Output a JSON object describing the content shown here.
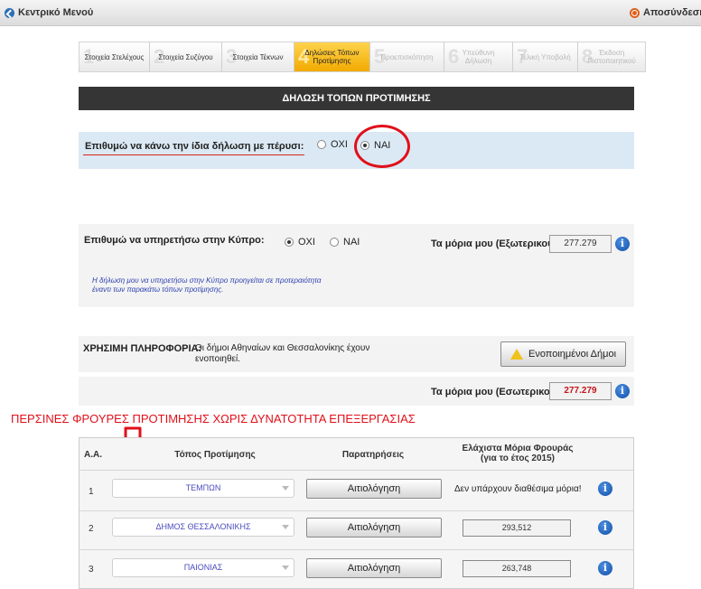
{
  "topbar": {
    "menu_label": "Κεντρικό Μενού",
    "logout_label": "Αποσύνδεση"
  },
  "steps": [
    {
      "num": "1",
      "label": "Στοιχεία Στελέχους",
      "state": "done"
    },
    {
      "num": "2",
      "label": "Στοιχεία Συζύγου",
      "state": "done"
    },
    {
      "num": "3",
      "label": "Στοιχεία Τέκνων",
      "state": "done"
    },
    {
      "num": "4",
      "label": "Δηλώσεις Τόπων Προτίμησης",
      "state": "active"
    },
    {
      "num": "5",
      "label": "Προεπισκόπηση",
      "state": "future"
    },
    {
      "num": "6",
      "label": "Υπεύθυνη Δήλωση",
      "state": "future"
    },
    {
      "num": "7",
      "label": "Τελική Υποβολή",
      "state": "future"
    },
    {
      "num": "8",
      "label": "Έκδοση Πιστοποιητικού",
      "state": "future"
    }
  ],
  "section_title": "ΔΗΛΩΣΗ ΤΟΠΩΝ ΠΡΟΤΙΜΗΣΗΣ",
  "same_as_last_year": {
    "question": "Επιθυμώ να κάνω την ίδια δήλωση με πέρυσι:",
    "option_no": "ΟΧΙ",
    "option_yes": "ΝΑΙ",
    "selected": "yes"
  },
  "cyprus": {
    "question": "Επιθυμώ να υπηρετήσω στην Κύπρο:",
    "option_no": "ΟΧΙ",
    "option_yes": "ΝΑΙ",
    "selected": "no",
    "points_label": "Τα μόρια μου (Εξωτερικού):",
    "points_value": "277.279",
    "note_line1": "Η δήλωση μου να υπηρετήσω στην Κύπρο προηγείται σε προτεραιότητα",
    "note_line2": "έναντι των παρακάτω τόπων προτίμησης."
  },
  "useful_info": {
    "title": "ΧΡΗΣΙΜΗ ΠΛΗΡΟΦΟΡΙΑ:",
    "text_line1": "Οι δήμοι Αθηναίων και Θεσσαλονίκης έχουν",
    "text_line2": "ενοποιηθεί.",
    "button_label": "Ενοποιημένοι Δήμοι"
  },
  "domestic_points": {
    "label": "Τα μόρια μου (Εσωτερικού):",
    "value": "277.279"
  },
  "annotation": "ΠΕΡΣΙΝΕΣ ΦΡΟΥΡΕΣ ΠΡΟΤΙΜΗΣΗΣ ΧΩΡΙΣ ΔΥΝΑΤΟΤΗΤΑ ΕΠΕΞΕΡΓΑΣΙΑΣ",
  "table": {
    "headers": {
      "aa": "Α.Α.",
      "place": "Τόπος Προτίμησης",
      "remarks": "Παρατηρήσεις",
      "min_points_line1": "Ελάχιστα Μόρια Φρουράς",
      "min_points_line2": "(για το έτος 2015)"
    },
    "rows": [
      {
        "aa": "1",
        "place": "ΤΕΜΠΩΝ",
        "button": "Αιτιολόγηση",
        "min_points": "Δεν υπάρχουν διαθέσιμα μόρια!"
      },
      {
        "aa": "2",
        "place": "ΔΗΜΟΣ ΘΕΣΣΑΛΟΝΙΚΗΣ",
        "button": "Αιτιολόγηση",
        "min_points": "293,512"
      },
      {
        "aa": "3",
        "place": "ΠΑΙΟΝΙΑΣ",
        "button": "Αιτιολόγηση",
        "min_points": "263,748"
      }
    ]
  },
  "colors": {
    "accent_red": "#e0101a",
    "step_active": "#f2aa00",
    "panel_blue": "#dbe9f4",
    "header_dark": "#353535"
  }
}
